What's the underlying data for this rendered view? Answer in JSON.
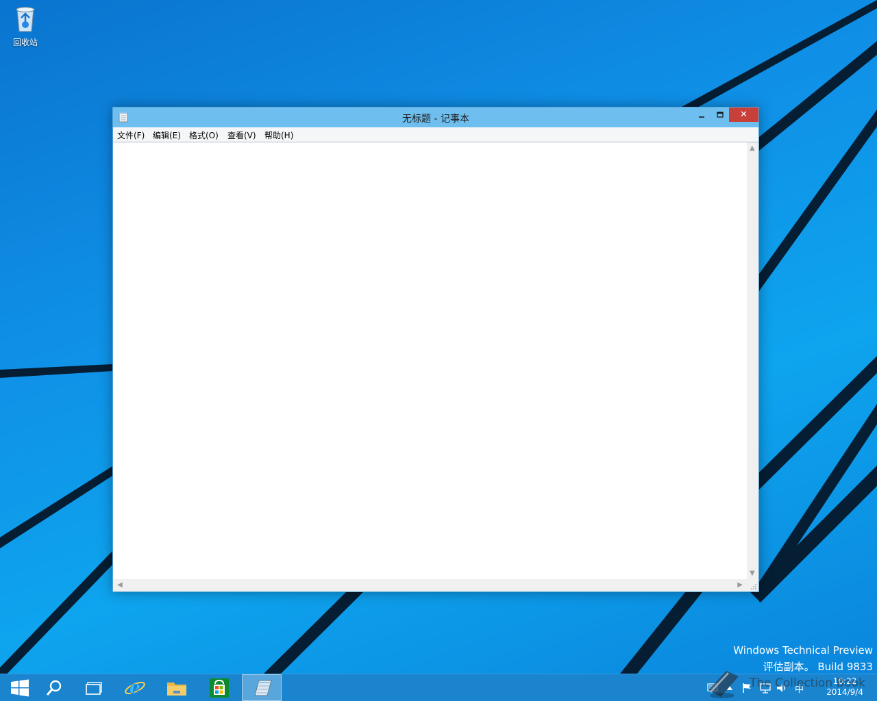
{
  "desktop": {
    "recycle_bin_label": "回收站"
  },
  "window": {
    "title": "无标题 - 记事本",
    "menu": [
      "文件(F)",
      "编辑(E)",
      "格式(O)",
      "查看(V)",
      "帮助(H)"
    ],
    "close_glyph": "✕",
    "editor_text": ""
  },
  "watermark": {
    "line1": "Windows Technical Preview",
    "line2": "评估副本。 Build 9833"
  },
  "taskbar": {
    "apps": [
      "start-icon",
      "search-icon",
      "task-view-icon",
      "internet-explorer-icon",
      "file-explorer-icon",
      "store-icon",
      "notepad-icon"
    ],
    "tray_ime": "中",
    "overlay_text": "The Collection Book"
  },
  "clock": {
    "time": "10:22",
    "date": "2014/9/4"
  },
  "colors": {
    "desktop_blue": "#0f8fe6",
    "titlebar": "#6ebff0",
    "close_red": "#c7403a",
    "taskbar": "#1a84cf"
  }
}
